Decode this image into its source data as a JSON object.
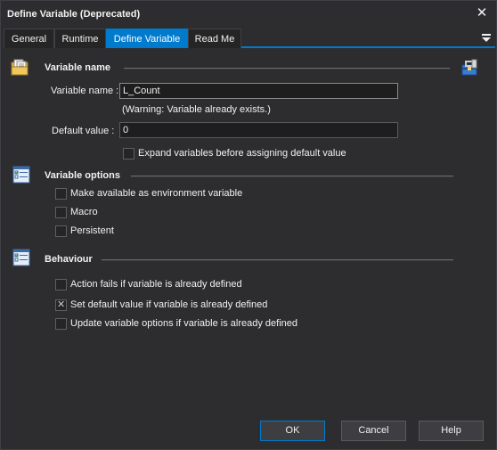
{
  "window": {
    "title": "Define Variable (Deprecated)"
  },
  "tabs": [
    {
      "label": "General",
      "active": false
    },
    {
      "label": "Runtime",
      "active": false
    },
    {
      "label": "Define Variable",
      "active": true
    },
    {
      "label": "Read Me",
      "active": false
    }
  ],
  "sections": {
    "variable_name": {
      "title": "Variable name",
      "name_label": "Variable name :",
      "name_value": "L_Count",
      "warning": "(Warning: Variable already exists.)",
      "default_label": "Default value :",
      "default_value": "0",
      "expand_label": "Expand variables before assigning default value",
      "expand_checked": false
    },
    "variable_options": {
      "title": "Variable options",
      "options": [
        {
          "label": "Make available as environment variable",
          "checked": false
        },
        {
          "label": "Macro",
          "checked": false
        },
        {
          "label": "Persistent",
          "checked": false
        }
      ]
    },
    "behaviour": {
      "title": "Behaviour",
      "options": [
        {
          "label": "Action fails if variable is already defined",
          "checked": false
        },
        {
          "label": "Set default value if variable is already defined",
          "checked": true
        },
        {
          "label": "Update variable options if variable is already defined",
          "checked": false
        }
      ]
    }
  },
  "buttons": {
    "ok": "OK",
    "cancel": "Cancel",
    "help": "Help"
  },
  "icons": {
    "close": "close-icon",
    "tab_menu": "menu-icon",
    "variable_name": "folder-documents-icon",
    "variable_options": "checklist-icon",
    "behaviour": "checklist-icon",
    "toolbox": "toolbox-icon"
  },
  "colors": {
    "background": "#2d2d30",
    "accent": "#007acc",
    "text": "#f1f1f1"
  }
}
